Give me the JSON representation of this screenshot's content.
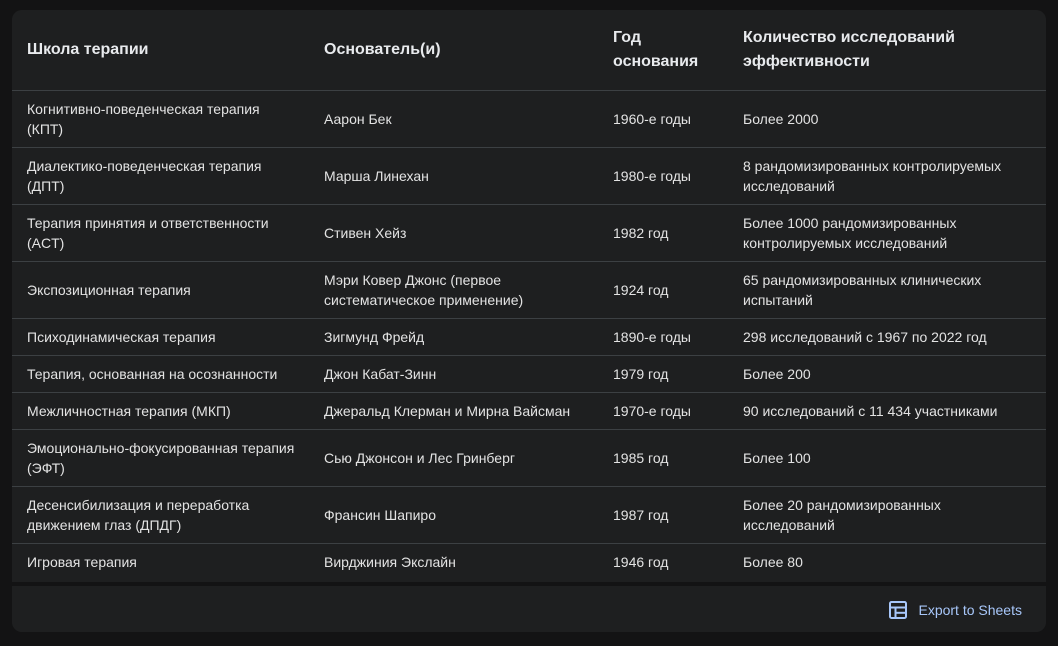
{
  "table": {
    "headers": [
      "Школа терапии",
      "Основатель(и)",
      "Год основания",
      "Количество исследований эффективности"
    ],
    "rows": [
      [
        "Когнитивно-поведенческая терапия (КПТ)",
        "Аарон Бек",
        "1960-е годы",
        "Более 2000"
      ],
      [
        "Диалектико-поведенческая терапия (ДПТ)",
        "Марша Линехан",
        "1980-е годы",
        "8 рандомизированных контролируемых исследований"
      ],
      [
        "Терапия принятия и ответственности (ACT)",
        "Стивен Хейз",
        "1982 год",
        "Более 1000 рандомизированных контролируемых исследований"
      ],
      [
        "Экспозиционная терапия",
        "Мэри Ковер Джонс (первое систематическое применение)",
        "1924 год",
        "65 рандомизированных клинических испытаний"
      ],
      [
        "Психодинамическая терапия",
        "Зигмунд Фрейд",
        "1890-е годы",
        "298 исследований с 1967 по 2022 год"
      ],
      [
        "Терапия, основанная на осознанности",
        "Джон Кабат-Зинн",
        "1979 год",
        "Более 200"
      ],
      [
        "Межличностная терапия (МКП)",
        "Джеральд Клерман и Мирна Вайсман",
        "1970-е годы",
        "90 исследований с 11 434 участниками"
      ],
      [
        "Эмоционально-фокусированная терапия (ЭФТ)",
        "Сью Джонсон и Лес Гринберг",
        "1985 год",
        "Более 100"
      ],
      [
        "Десенсибилизация и переработка движением глаз (ДПДГ)",
        "Франсин Шапиро",
        "1987 год",
        "Более 20 рандомизированных исследований"
      ],
      [
        "Игровая терапия",
        "Вирджиния Экслайн",
        "1946 год",
        "Более 80"
      ]
    ]
  },
  "footer": {
    "export_label": "Export to Sheets",
    "export_icon": "table-grid-icon"
  },
  "colors": {
    "background": "#131314",
    "panel": "#1e1f20",
    "divider": "#3c4043",
    "text": "#e3e3e3",
    "accent": "#a8c7fa"
  }
}
